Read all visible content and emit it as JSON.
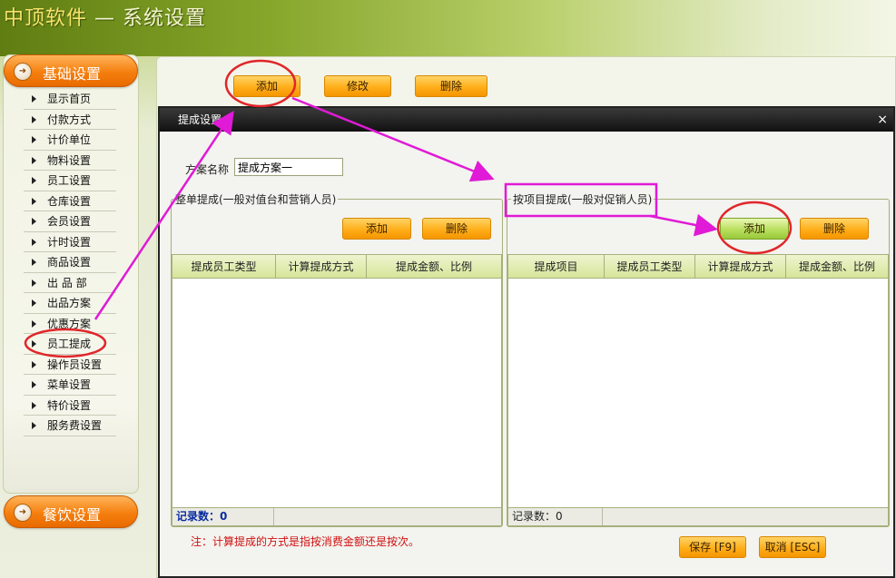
{
  "header": {
    "brand": "中顶软件",
    "separator": " — ",
    "title": "系统设置"
  },
  "sidebar": {
    "sections": [
      {
        "label": "基础设置",
        "icon": "chevron-right-circle-icon"
      },
      {
        "label": "餐饮设置",
        "icon": "chevron-right-circle-icon"
      }
    ],
    "items": [
      {
        "label": "显示首页"
      },
      {
        "label": "付款方式"
      },
      {
        "label": "计价单位"
      },
      {
        "label": "物料设置"
      },
      {
        "label": "员工设置"
      },
      {
        "label": "仓库设置"
      },
      {
        "label": "会员设置"
      },
      {
        "label": "计时设置"
      },
      {
        "label": "商品设置"
      },
      {
        "label": "出 品 部"
      },
      {
        "label": "出品方案"
      },
      {
        "label": "优惠方案"
      },
      {
        "label": "员工提成"
      },
      {
        "label": "操作员设置"
      },
      {
        "label": "菜单设置"
      },
      {
        "label": "特价设置"
      },
      {
        "label": "服务费设置"
      }
    ]
  },
  "toolbar": {
    "add": "添加",
    "edit": "修改",
    "delete": "删除"
  },
  "dialog": {
    "title": "提成设置",
    "close": "×",
    "scheme_label": "方案名称",
    "scheme_value": "提成方案一",
    "left_group": {
      "legend": "整单提成(一般对值台和营销人员)",
      "add": "添加",
      "delete": "删除",
      "columns": [
        "提成员工类型",
        "计算提成方式",
        "提成金额、比例"
      ],
      "footer": "记录数：0"
    },
    "right_group": {
      "legend": "按项目提成(一般对促销人员)",
      "add": "添加",
      "delete": "删除",
      "columns": [
        "提成项目",
        "提成员工类型",
        "计算提成方式",
        "提成金额、比例"
      ],
      "footer": "记录数：0"
    },
    "note": "注：计算提成的方式是指按消费金额还是按次。",
    "save": "保存 [F9]",
    "cancel": "取消 [ESC]"
  },
  "colors": {
    "annotation": "#e01ad6",
    "highlight": "#e0262a",
    "button": "#ffae1a"
  }
}
